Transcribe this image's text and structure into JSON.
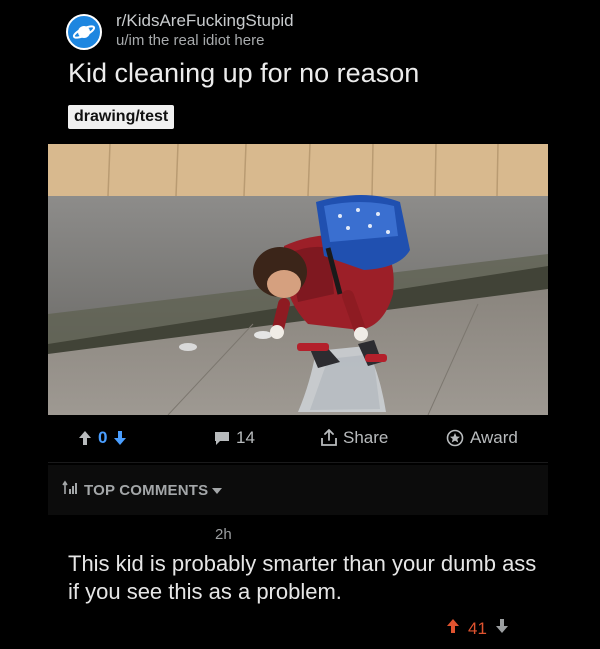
{
  "post": {
    "subreddit": "r/KidsAreFuckingStupid",
    "user": "u/im the real idiot here",
    "title": "Kid cleaning up for no reason",
    "flair": "drawing/test"
  },
  "actions": {
    "vote_count": "0",
    "comment_count": "14",
    "share_label": "Share",
    "award_label": "Award"
  },
  "comments_section": {
    "header": "TOP COMMENTS",
    "comment": {
      "time": "2h",
      "body": "This kid is probably smarter than your dumb ass if you see this as a problem.",
      "votes": "41"
    }
  },
  "icons": {
    "subreddit": "planet-icon",
    "upvote": "arrow-up-icon",
    "downvote": "arrow-down-icon",
    "comments": "speech-bubble-icon",
    "share": "share-icon",
    "award": "award-star-icon",
    "sort": "sort-icon",
    "dropdown": "caret-down-icon"
  },
  "colors": {
    "background": "#000000",
    "upvote_blue": "#4a9eff",
    "upvote_orange": "#e0532f",
    "subreddit_blue": "#1d86e0"
  }
}
